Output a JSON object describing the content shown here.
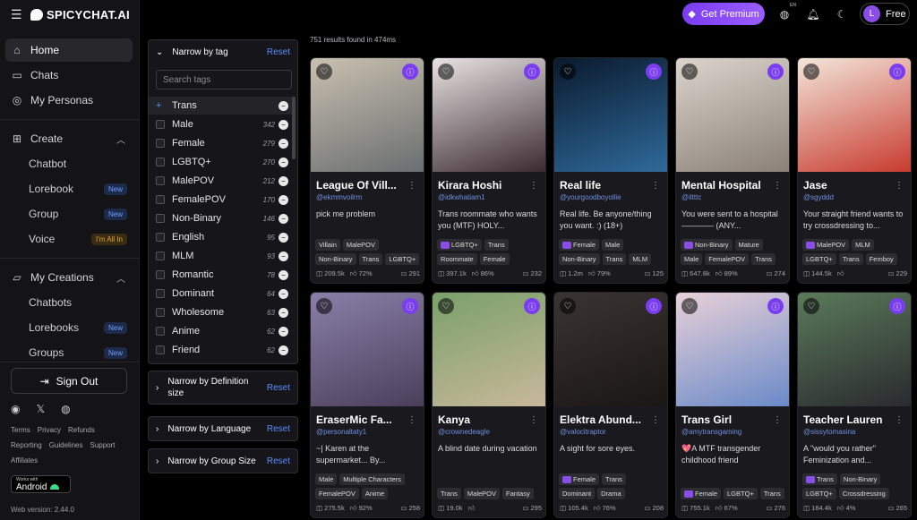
{
  "brand": "SPICYCHAT.AI",
  "nav": {
    "home": "Home",
    "chats": "Chats",
    "personas": "My Personas",
    "create": "Create",
    "chatbot": "Chatbot",
    "lorebook": "Lorebook",
    "group": "Group",
    "voice": "Voice",
    "my_creations": "My Creations",
    "chatbots": "Chatbots",
    "lorebooks": "Lorebooks",
    "groups": "Groups"
  },
  "badges": {
    "new": "New",
    "all_in": "I'm All In"
  },
  "sign_out": "Sign Out",
  "footer": {
    "terms": "Terms",
    "privacy": "Privacy",
    "refunds": "Refunds",
    "reporting": "Reporting",
    "guidelines": "Guidelines",
    "support": "Support",
    "affiliates": "Affiliates",
    "android_small": "Works with",
    "android": "Android",
    "version": "Web version: 2.44.0"
  },
  "topbar": {
    "premium": "Get Premium",
    "lang": "EN",
    "plan": "Free",
    "avatar": "L"
  },
  "filters": {
    "tag_title": "Narrow by tag",
    "reset": "Reset",
    "search_placeholder": "Search tags",
    "def_size": "Narrow by Definition size",
    "language": "Narrow by Language",
    "group_size": "Narrow by Group Size"
  },
  "tags": [
    {
      "name": "Trans",
      "count": ""
    },
    {
      "name": "Male",
      "count": "342"
    },
    {
      "name": "Female",
      "count": "279"
    },
    {
      "name": "LGBTQ+",
      "count": "270"
    },
    {
      "name": "MalePOV",
      "count": "212"
    },
    {
      "name": "FemalePOV",
      "count": "170"
    },
    {
      "name": "Non-Binary",
      "count": "146"
    },
    {
      "name": "English",
      "count": "95"
    },
    {
      "name": "MLM",
      "count": "93"
    },
    {
      "name": "Romantic",
      "count": "78"
    },
    {
      "name": "Dominant",
      "count": "64"
    },
    {
      "name": "Wholesome",
      "count": "63"
    },
    {
      "name": "Anime",
      "count": "62"
    },
    {
      "name": "Friend",
      "count": "62"
    }
  ],
  "results": "751 results found in 474ms",
  "cards": [
    {
      "title": "League Of Vill...",
      "author": "@ekmmvoilrm",
      "desc": "pick me problem",
      "tags": [
        "Villain",
        "MalePOV",
        "Non-Binary",
        "Trans",
        "LGBTQ+"
      ],
      "views": "209.5k",
      "likes": "72%",
      "chats": "291",
      "colors": [
        "#c9c0b0",
        "#6a6e70"
      ]
    },
    {
      "title": "Kirara Hoshi",
      "author": "@idkwhatiam1",
      "desc": "Trans roommate who wants you (MTF) HOLY...",
      "tags": [
        "#LGBTQ+",
        "Trans",
        "Roommate",
        "Female"
      ],
      "views": "397.1k",
      "likes": "86%",
      "chats": "232",
      "colors": [
        "#e9e2e3",
        "#3a2a30"
      ]
    },
    {
      "title": "Real life",
      "author": "@yourgoodboyollie",
      "desc": "Real life. Be anyone/thing you want. :) (18+)",
      "tags": [
        "#Female",
        "Male",
        "Non-Binary",
        "Trans",
        "MLM"
      ],
      "views": "1.2m",
      "likes": "79%",
      "chats": "125",
      "colors": [
        "#0a1a2e",
        "#2f6a9a"
      ]
    },
    {
      "title": "Mental Hospital",
      "author": "@iltttc",
      "desc": "You were sent to a hospital———— (ANY...",
      "tags": [
        "#Non-Binary",
        "Mature",
        "Male",
        "FemalePOV",
        "Trans"
      ],
      "views": "647.8k",
      "likes": "89%",
      "chats": "274",
      "colors": [
        "#dcd4cc",
        "#8a8078"
      ]
    },
    {
      "title": "Jase",
      "author": "@sgyddd",
      "desc": "Your straight friend wants to try crossdressing to...",
      "tags": [
        "#MalePOV",
        "MLM",
        "LGBTQ+",
        "Trans",
        "Femboy"
      ],
      "views": "144.5k",
      "likes": "",
      "chats": "229",
      "colors": [
        "#f3e6da",
        "#c83a2e"
      ]
    },
    {
      "title": "EraserMic Fa...",
      "author": "@personaltaty1",
      "desc": "~| Karen at the supermarket... By...",
      "tags": [
        "Male",
        "Multiple Characters",
        "FemalePOV",
        "Anime"
      ],
      "views": "275.5k",
      "likes": "92%",
      "chats": "258",
      "colors": [
        "#8a7fa8",
        "#4a3f5a"
      ]
    },
    {
      "title": "Kanya",
      "author": "@crownedeagle",
      "desc": "A blind date during vacation",
      "tags": [
        "Trans",
        "MalePOV",
        "Fantasy"
      ],
      "views": "19.0k",
      "likes": "",
      "chats": "295",
      "colors": [
        "#7aa06a",
        "#c8b89a"
      ]
    },
    {
      "title": "Elektra Abund...",
      "author": "@valocitraptor",
      "desc": "A sight for sore eyes.",
      "tags": [
        "#Female",
        "Trans",
        "Dominant",
        "Drama"
      ],
      "views": "105.4k",
      "likes": "76%",
      "chats": "208",
      "colors": [
        "#3a3432",
        "#1a1614"
      ]
    },
    {
      "title": "Trans Girl",
      "author": "@amytransgaming",
      "desc": "💖A MTF transgender childhood friend",
      "tags": [
        "#Female",
        "LGBTQ+",
        "Trans"
      ],
      "views": "755.1k",
      "likes": "67%",
      "chats": "276",
      "colors": [
        "#e8d0d8",
        "#6a8ac8"
      ]
    },
    {
      "title": "Teacher Lauren",
      "author": "@sissytomasina",
      "desc": "A \"would you rather\" Feminization and...",
      "tags": [
        "#Trans",
        "Non-Binary",
        "LGBTQ+",
        "Crossdressing"
      ],
      "views": "184.4k",
      "likes": "4%",
      "chats": "265",
      "colors": [
        "#5a7a5a",
        "#2a2a2e"
      ]
    }
  ]
}
